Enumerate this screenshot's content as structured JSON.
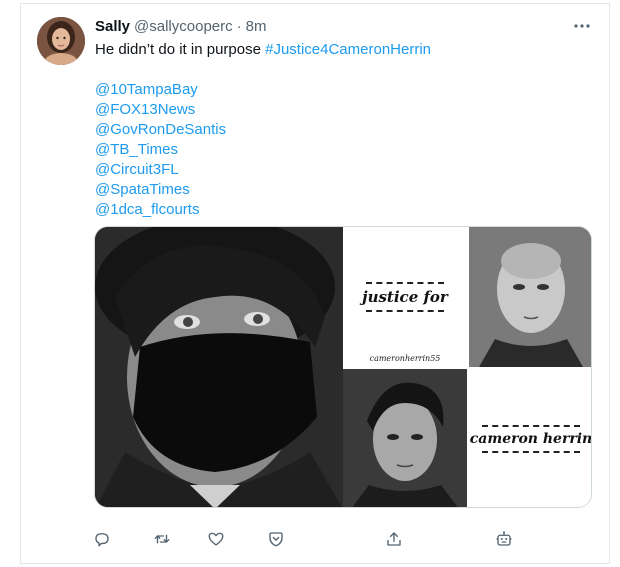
{
  "tweet": {
    "author": {
      "display_name": "Sally",
      "handle": "@sallycooperc",
      "separator": "·",
      "time": "8m"
    },
    "text": {
      "prefix": "He didn’t do it in purpose ",
      "hashtag": "#Justice4CameronHerrin"
    },
    "mentions": [
      "@10TampaBay",
      "@FOX13News",
      "@GovRonDeSantis",
      "@TB_Times",
      "@Circuit3FL",
      "@SpataTimes",
      "@1dca_flcourts"
    ],
    "media": {
      "collage_texts": {
        "justice_for": "justice for",
        "handle_text": "cameronherrin55",
        "name_text": "cameron herrin"
      }
    },
    "actions": [
      {
        "name": "reply",
        "icon": "reply-icon"
      },
      {
        "name": "retweet",
        "icon": "retweet-icon"
      },
      {
        "name": "like",
        "icon": "heart-icon"
      },
      {
        "name": "hide",
        "icon": "shield-icon"
      },
      {
        "name": "share",
        "icon": "share-icon"
      },
      {
        "name": "bot",
        "icon": "robot-icon"
      }
    ]
  },
  "colors": {
    "link": "#1d9bf0",
    "secondary_text": "#536471",
    "border": "#cfd9de"
  }
}
